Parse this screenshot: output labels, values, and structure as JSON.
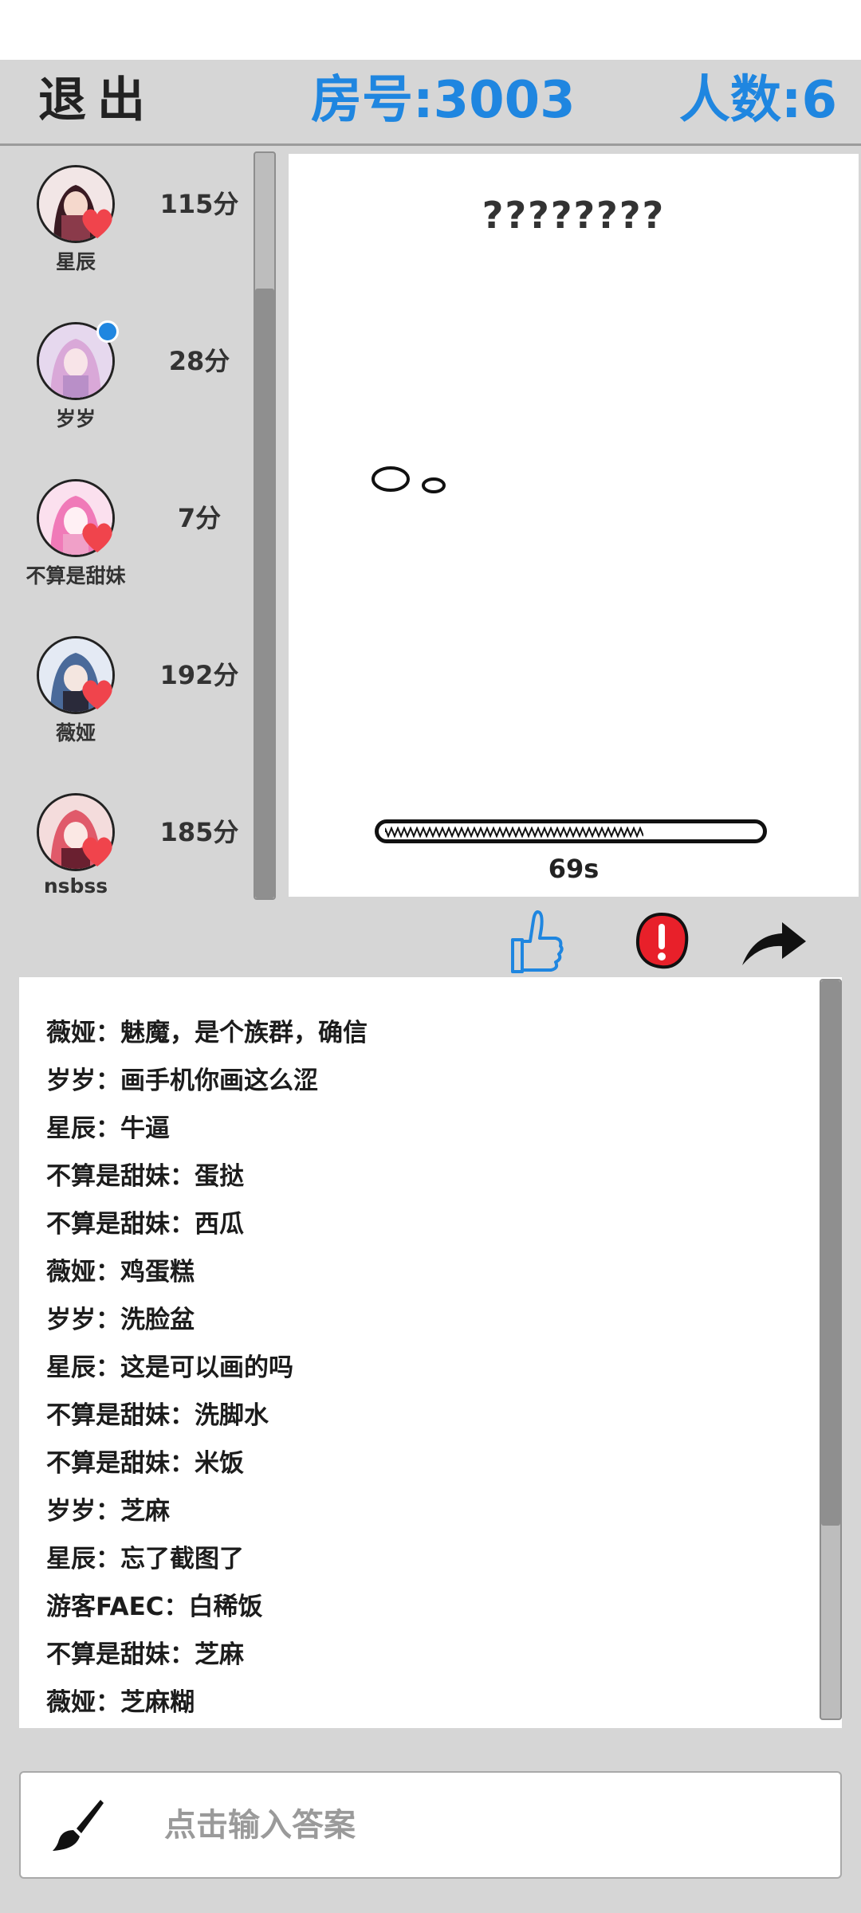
{
  "header": {
    "exit_label": "退出",
    "room_label": "房号:3003",
    "people_label": "人数:6"
  },
  "players": [
    {
      "name": "星辰",
      "score": "115分",
      "badge": "heart-icon",
      "avatar_color": "#8a3a4a"
    },
    {
      "name": "岁岁",
      "score": "28分",
      "badge": "online-dot",
      "avatar_color": "#c9a3d6"
    },
    {
      "name": "不算是甜妹",
      "score": "7分",
      "badge": "heart-icon",
      "avatar_color": "#f0a0c8"
    },
    {
      "name": "薇娅",
      "score": "192分",
      "badge": "heart-icon",
      "avatar_color": "#6a88b8"
    },
    {
      "name": "nsbss",
      "score": "185分",
      "badge": "heart-icon",
      "avatar_color": "#e05a6a"
    }
  ],
  "canvas": {
    "hint": "????????",
    "timer_label": "69s",
    "time_remaining_fraction": 0.69
  },
  "actions": [
    {
      "name": "like-button",
      "icon": "thumbs-up-icon",
      "color": "#1f86e0"
    },
    {
      "name": "report-button",
      "icon": "exclamation-icon",
      "color": "#e8202a"
    },
    {
      "name": "share-button",
      "icon": "share-arrow-icon",
      "color": "#111111"
    }
  ],
  "chat": {
    "messages": [
      "薇娅：魅魔，是个族群，确信",
      "岁岁：画手机你画这么涩",
      "星辰：牛逼",
      "不算是甜妹：蛋挞",
      "不算是甜妹：西瓜",
      "薇娅：鸡蛋糕",
      "岁岁：洗脸盆",
      "星辰：这是可以画的吗",
      "不算是甜妹：洗脚水",
      "不算是甜妹：米饭",
      "岁岁：芝麻",
      "星辰：忘了截图了",
      "游客FAEC：白稀饭",
      "不算是甜妹：芝麻",
      "薇娅：芝麻糊"
    ]
  },
  "input": {
    "placeholder": "点击输入答案",
    "value": ""
  }
}
